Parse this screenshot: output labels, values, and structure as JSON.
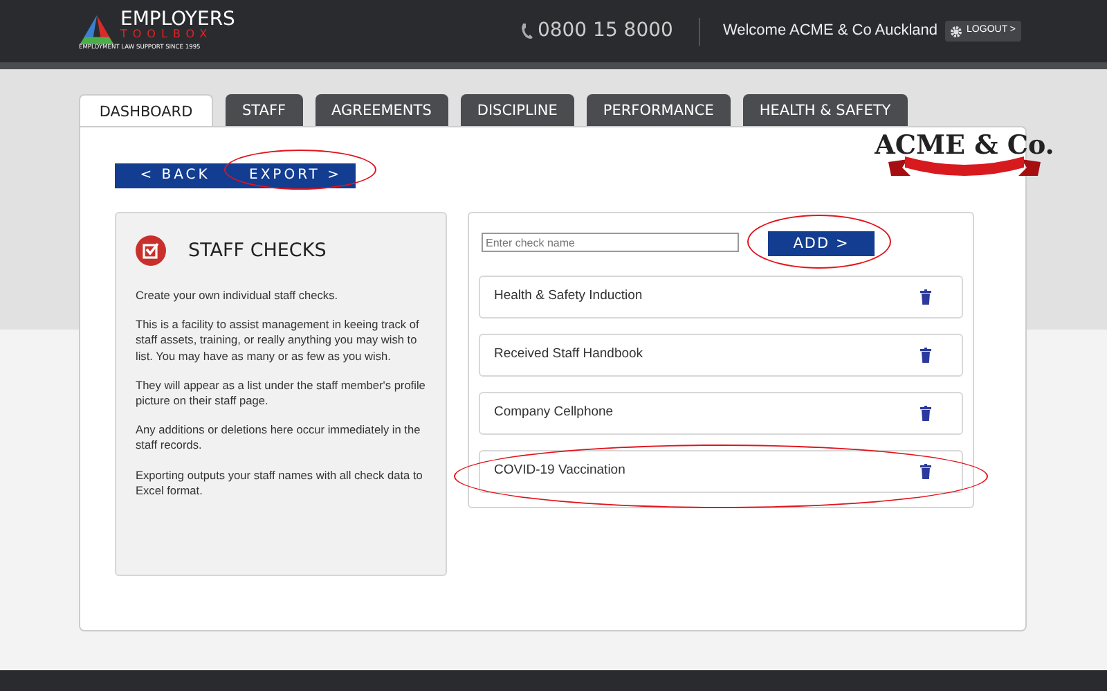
{
  "header": {
    "logo": {
      "word": "EMPLOYERS",
      "subword": "TOOLBOX",
      "tagline": "EMPLOYMENT LAW SUPPORT SINCE 1995"
    },
    "phone": "0800 15 8000",
    "welcome": "Welcome ACME & Co Auckland",
    "logout": "LOGOUT >"
  },
  "tabs": [
    {
      "label": "DASHBOARD",
      "selected": true
    },
    {
      "label": "STAFF",
      "selected": false
    },
    {
      "label": "AGREEMENTS",
      "selected": false
    },
    {
      "label": "DISCIPLINE",
      "selected": false
    },
    {
      "label": "PERFORMANCE",
      "selected": false
    },
    {
      "label": "HEALTH & SAFETY",
      "selected": false
    }
  ],
  "actions": [
    {
      "label": "< BACK",
      "highlighted": false
    },
    {
      "label": "EXPORT >",
      "highlighted": true
    }
  ],
  "company_logo": "ACME & Co.",
  "info_panel": {
    "title": "STAFF CHECKS",
    "paragraphs": [
      "Create your own individual staff checks.",
      "This is a facility to assist management in keeing track of staff assets, training, or really anything you may wish to list. You may have as many or as few as you wish.",
      "They will appear as a list under the staff member's profile picture on their staff page.",
      "Any additions or deletions here occur immediately in the staff records.",
      "Exporting outputs your staff names with all check data to Excel format."
    ]
  },
  "add_form": {
    "placeholder": "Enter check name",
    "button": "ADD >",
    "highlighted": true
  },
  "checks": [
    {
      "name": "Health & Safety Induction",
      "highlighted": false
    },
    {
      "name": "Received Staff Handbook",
      "highlighted": false
    },
    {
      "name": "Company Cellphone",
      "highlighted": false
    },
    {
      "name": "COVID-19 Vaccination",
      "highlighted": true
    }
  ]
}
